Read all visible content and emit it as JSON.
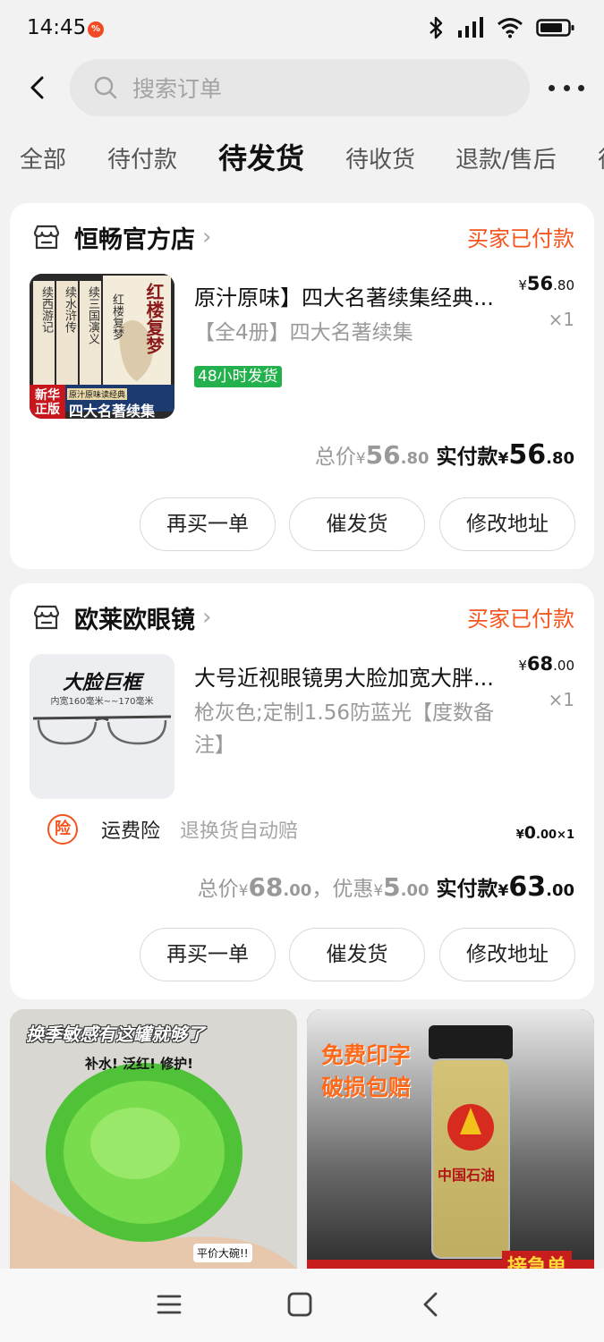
{
  "status_bar": {
    "time": "14:45",
    "notif_badge": "%"
  },
  "header": {
    "search_placeholder": "搜索订单"
  },
  "tabs": [
    {
      "label": "全部",
      "active": false
    },
    {
      "label": "待付款",
      "active": false
    },
    {
      "label": "待发货",
      "active": true
    },
    {
      "label": "待收货",
      "active": false
    },
    {
      "label": "退款/售后",
      "active": false
    },
    {
      "label": "待",
      "active": false
    }
  ],
  "orders": [
    {
      "shop_name": "恒畅官方店",
      "status": "买家已付款",
      "product_title": "原汁原味】四大名著续集经典...",
      "spec": "【全4册】四大名著续集",
      "badge": "48小时发货",
      "price_cur": "¥",
      "price_int": "56",
      "price_dec": ".80",
      "qty": "×1",
      "total_label": "总价",
      "total_cur": "¥",
      "total_int": "56",
      "total_dec": ".80",
      "pay_label": "实付款",
      "pay_cur": "¥",
      "pay_int": "56",
      "pay_dec": ".80",
      "thumb": {
        "books": [
          "续西游记",
          "续水浒传",
          "续三国演义",
          "红楼复梦"
        ],
        "cover_title": "红楼复梦",
        "banner_top": "原汁原味读经典",
        "banner": "四大名著续集",
        "stamp": "新华正版"
      },
      "buttons": [
        "再买一单",
        "催发货",
        "修改地址"
      ]
    },
    {
      "shop_name": "欧莱欧眼镜",
      "status": "买家已付款",
      "product_title": "大号近视眼镜男大脸加宽大胖...",
      "spec": "枪灰色;定制1.56防蓝光【度数备注】",
      "price_cur": "¥",
      "price_int": "68",
      "price_dec": ".00",
      "qty": "×1",
      "insurance": {
        "icon": "险",
        "name": "运费险",
        "desc": "退换货自动赔",
        "price_cur": "¥",
        "price_int": "0",
        "price_dec": ".00",
        "qty": "×1"
      },
      "total_label": "总价",
      "total_cur": "¥",
      "total_int": "68",
      "total_dec": ".00",
      "discount_label": "，优惠",
      "discount_cur": "¥",
      "discount_int": "5",
      "discount_dec": ".00",
      "pay_label": "实付款",
      "pay_cur": "¥",
      "pay_int": "63",
      "pay_dec": ".00",
      "thumb": {
        "headline": "大脸巨框",
        "sub": "内宽160毫米~~170毫米"
      },
      "buttons": [
        "再买一单",
        "催发货",
        "修改地址"
      ]
    }
  ],
  "recommendations": [
    {
      "headline": "换季敏感有这罐就够了",
      "sub": "补水! 泛红! 修护!",
      "tag": "平价大碗!!"
    },
    {
      "line1": "免费印字",
      "line2": "破损包赔",
      "brand": "中国石油",
      "corner": "接急单"
    }
  ],
  "colors": {
    "accent": "#f5541e",
    "badge_green": "#23b14d",
    "bg": "#f2f2f2"
  }
}
